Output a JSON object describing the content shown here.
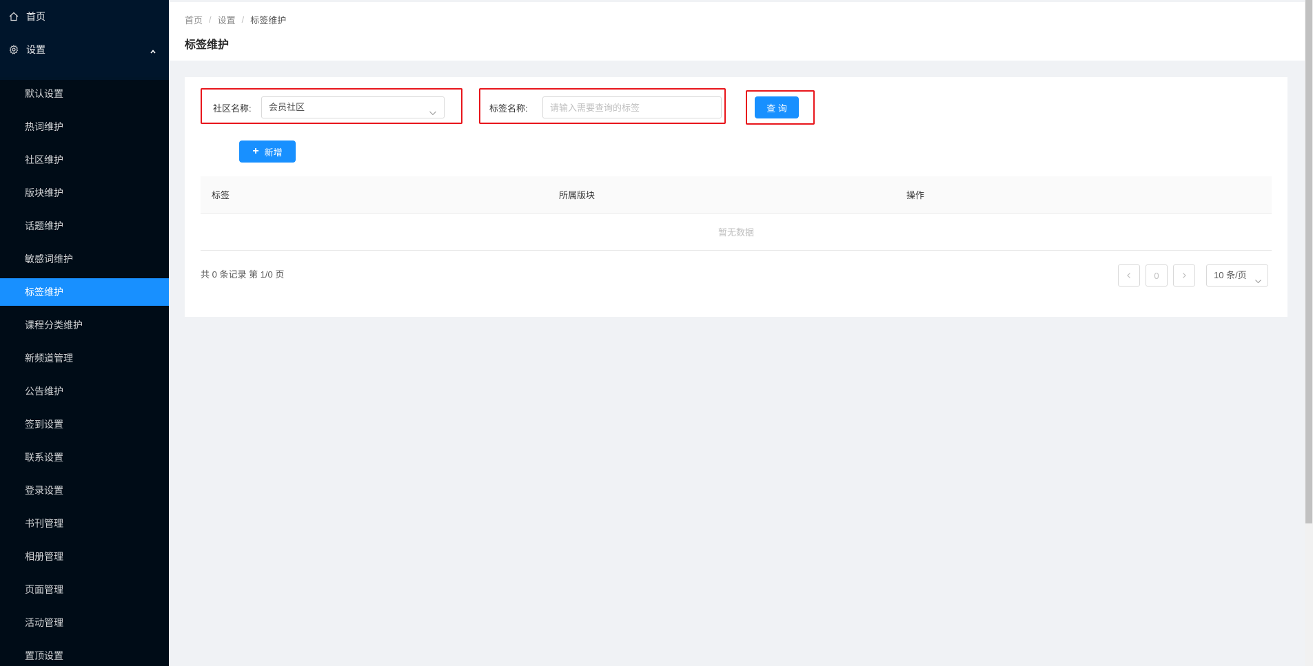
{
  "sidebar": {
    "home_label": "首页",
    "settings_label": "设置",
    "items": [
      {
        "label": "默认设置"
      },
      {
        "label": "热词维护"
      },
      {
        "label": "社区维护"
      },
      {
        "label": "版块维护"
      },
      {
        "label": "话题维护"
      },
      {
        "label": "敏感词维护"
      },
      {
        "label": "标签维护"
      },
      {
        "label": "课程分类维护"
      },
      {
        "label": "新频道管理"
      },
      {
        "label": "公告维护"
      },
      {
        "label": "签到设置"
      },
      {
        "label": "联系设置"
      },
      {
        "label": "登录设置"
      },
      {
        "label": "书刊管理"
      },
      {
        "label": "相册管理"
      },
      {
        "label": "页面管理"
      },
      {
        "label": "活动管理"
      },
      {
        "label": "置顶设置"
      }
    ],
    "active_item": "标签维护"
  },
  "header": {
    "breadcrumb": [
      "首页",
      "设置",
      "标签维护"
    ],
    "separator": "/",
    "title": "标签维护"
  },
  "filters": {
    "community_label": "社区名称:",
    "community_value": "会员社区",
    "tag_label": "标签名称:",
    "tag_placeholder": "请输入需要查询的标签",
    "tag_value": "",
    "query_button": "查 询"
  },
  "add_button": "新增",
  "table": {
    "columns": [
      "标签",
      "所属版块",
      "操作"
    ],
    "empty_text": "暂无数据"
  },
  "pagination": {
    "summary": "共 0 条记录 第 1/0 页",
    "current_page": "0",
    "page_size": "10 条/页"
  },
  "colors": {
    "sidebar_bg": "#001529",
    "submenu_bg": "#000c17",
    "primary": "#1890ff",
    "highlight_border": "#e8151b"
  }
}
